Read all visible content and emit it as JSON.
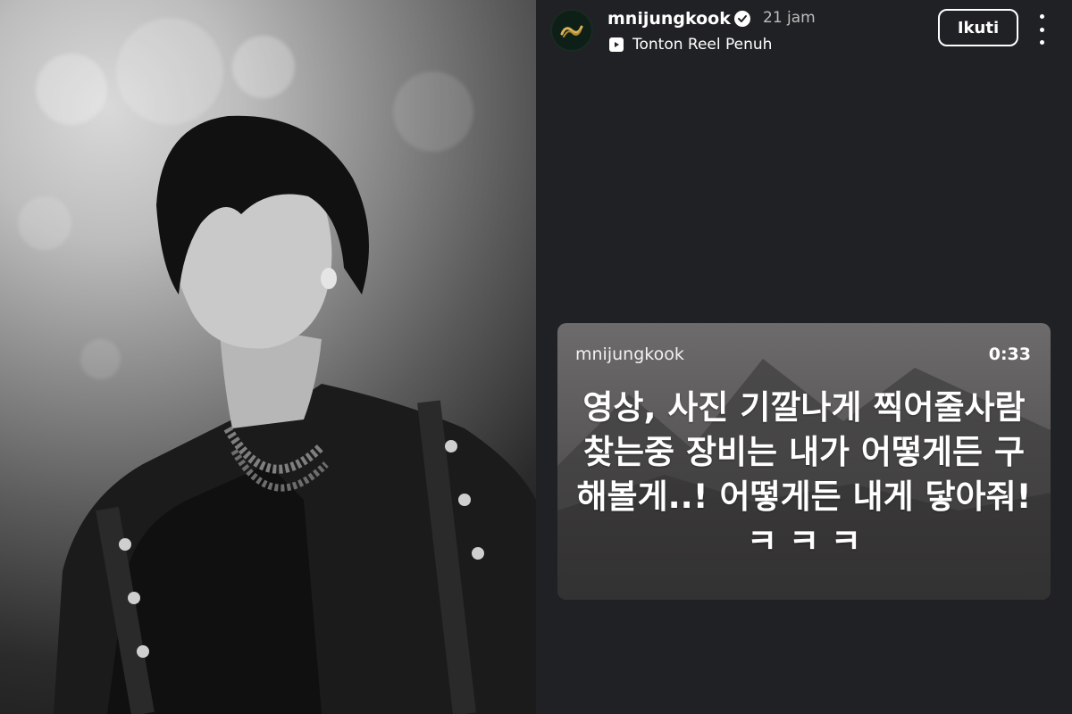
{
  "story": {
    "username": "mnijungkook",
    "time_ago": "21 jam",
    "reel_link": "Tonton Reel Penuh",
    "follow_label": "Ikuti"
  },
  "reel_card": {
    "username": "mnijungkook",
    "duration": "0:33",
    "caption": "영상, 사진 기깔나게 찍어줄사람 찾는중 장비는 내가 어떻게든 구해볼게..! 어떻게든 내게 닿아줘! ㅋ ㅋ ㅋ"
  },
  "colors": {
    "background": "#202124",
    "text": "#ffffff"
  }
}
